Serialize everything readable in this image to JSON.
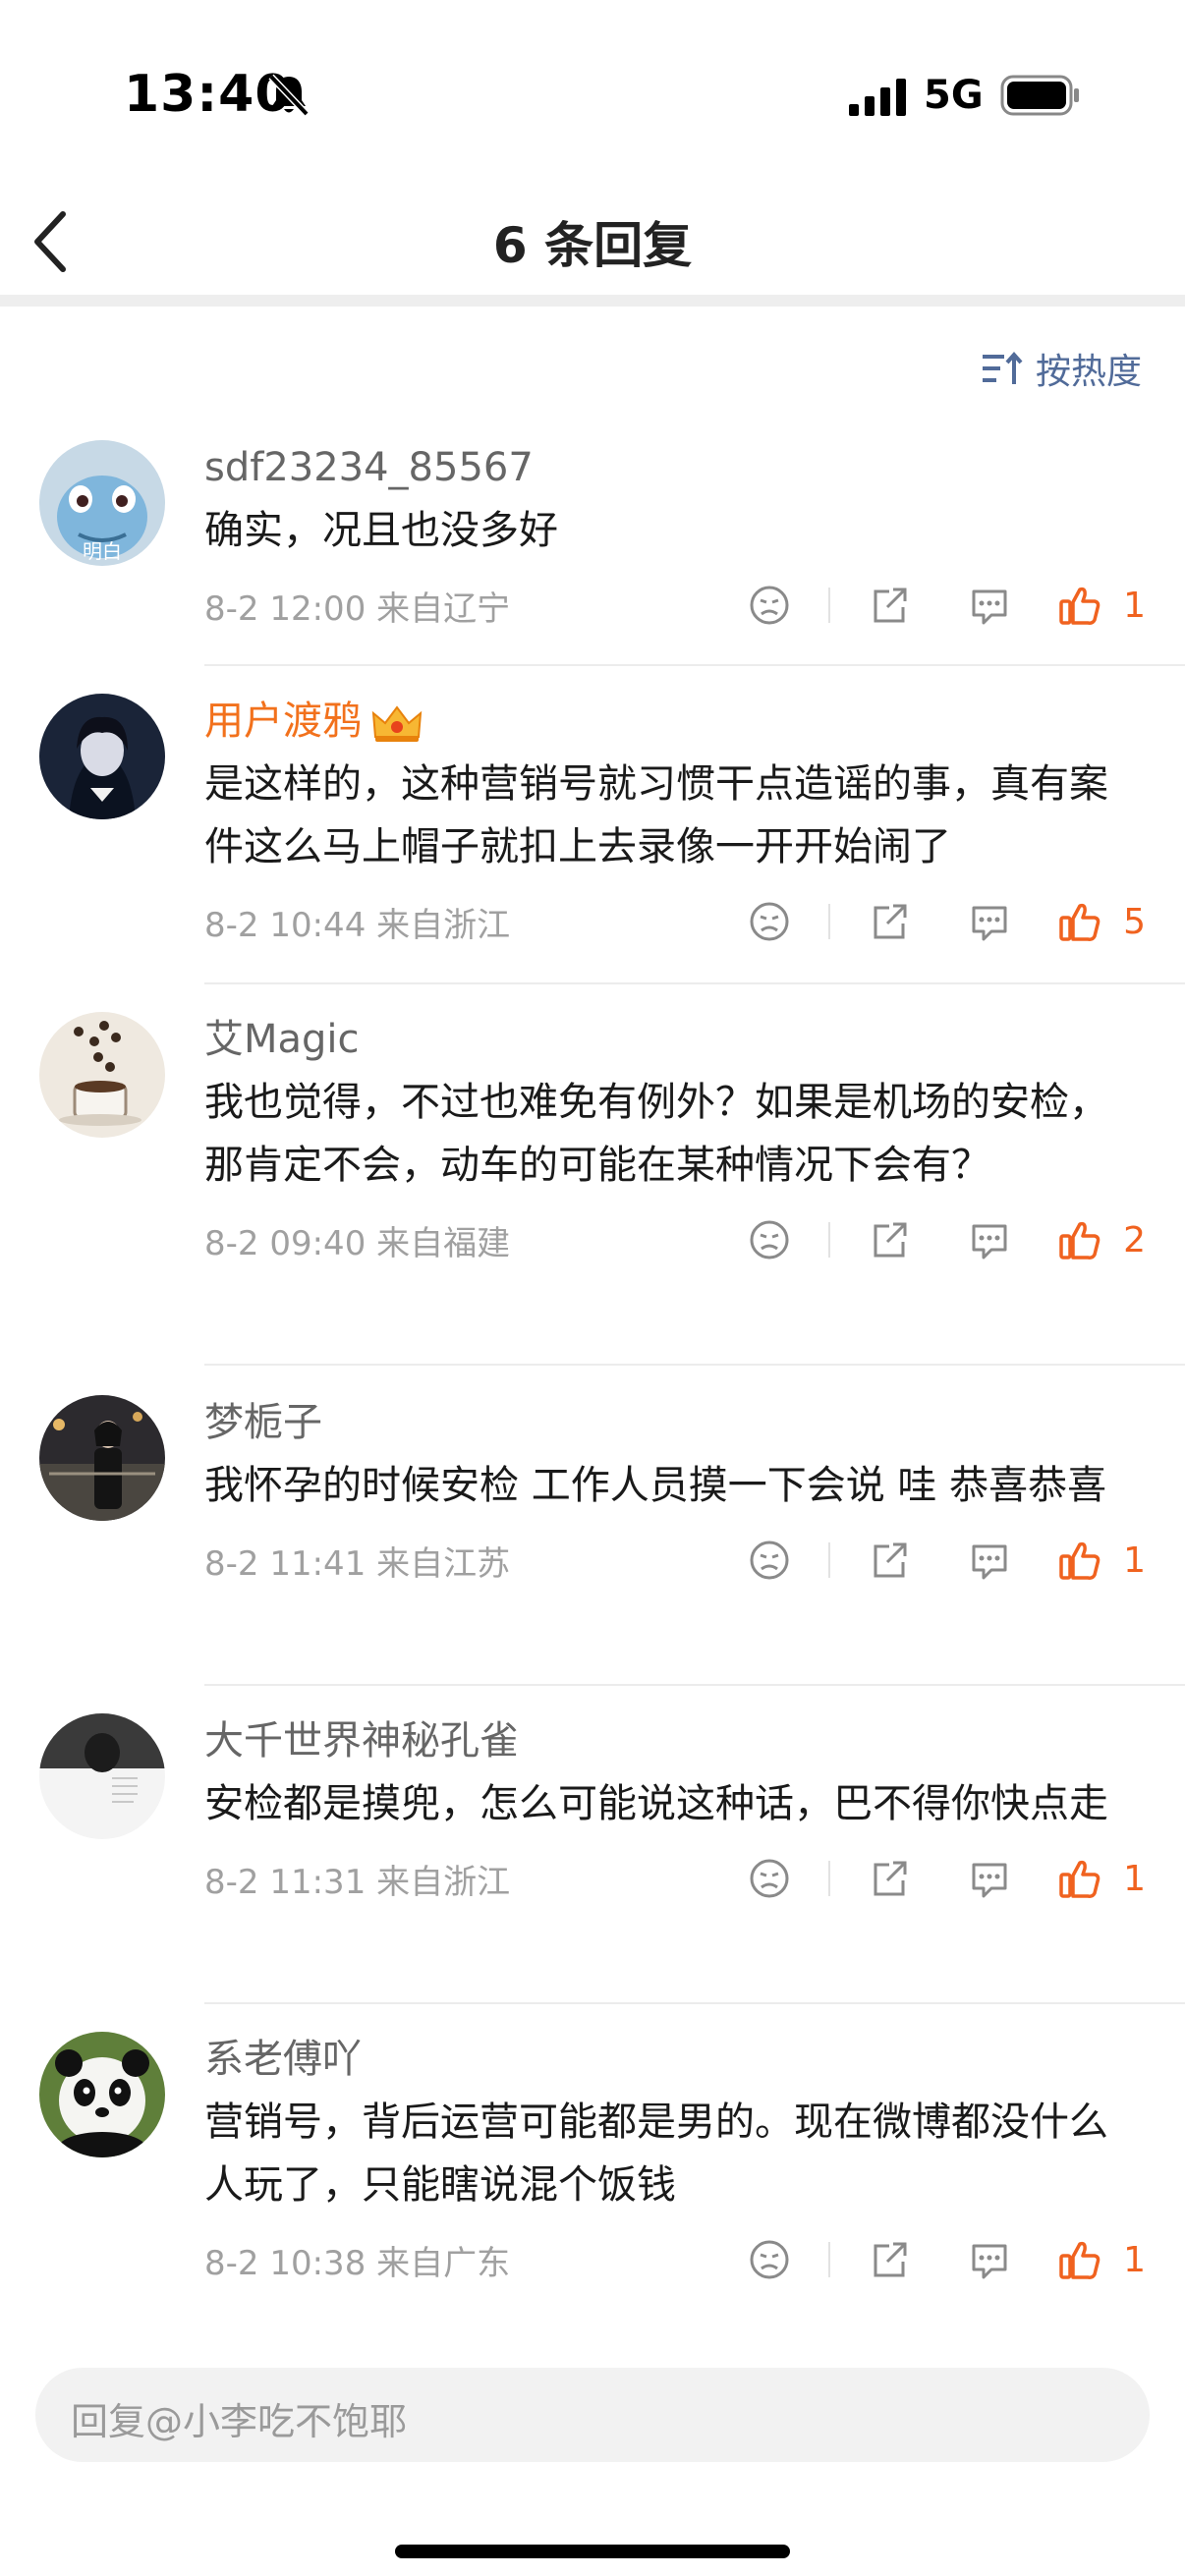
{
  "status_bar": {
    "time": "13:40",
    "network": "5G"
  },
  "header": {
    "title": "6 条回复"
  },
  "sort": {
    "label": "按热度"
  },
  "comments": [
    {
      "name": "sdf23234_85567",
      "avatar_label": "明白",
      "text": "确实，况且也没多好",
      "time": "8-2 12:00 来自辽宁",
      "likes": "1"
    },
    {
      "name": "用户渡鸦",
      "text": "是这样的，这种营销号就习惯干点造谣的事，真有案件这么马上帽子就扣上去录像一开开始闹了",
      "time": "8-2 10:44 来自浙江",
      "likes": "5"
    },
    {
      "name": "艾Magic",
      "text": "我也觉得，不过也难免有例外？如果是机场的安检，那肯定不会，动车的可能在某种情况下会有？",
      "time": "8-2 09:40 来自福建",
      "likes": "2"
    },
    {
      "name": "梦栀子",
      "text": "我怀孕的时候安检 工作人员摸一下会说 哇 恭喜恭喜",
      "time": "8-2 11:41 来自江苏",
      "likes": "1"
    },
    {
      "name": "大千世界神秘孔雀",
      "text": "安检都是摸兜，怎么可能说这种话，巴不得你快点走",
      "time": "8-2 11:31 来自浙江",
      "likes": "1"
    },
    {
      "name": "系老傅吖",
      "text": "营销号，背后运营可能都是男的。现在微博都没什么人玩了，只能瞎说混个饭钱",
      "time": "8-2 10:38 来自广东",
      "likes": "1"
    }
  ],
  "reply_bar": {
    "placeholder": "回复@小李吃不饱耶"
  },
  "colors": {
    "like": "#f0621f",
    "vip_name": "#f2711c",
    "sort": "#516b99"
  }
}
